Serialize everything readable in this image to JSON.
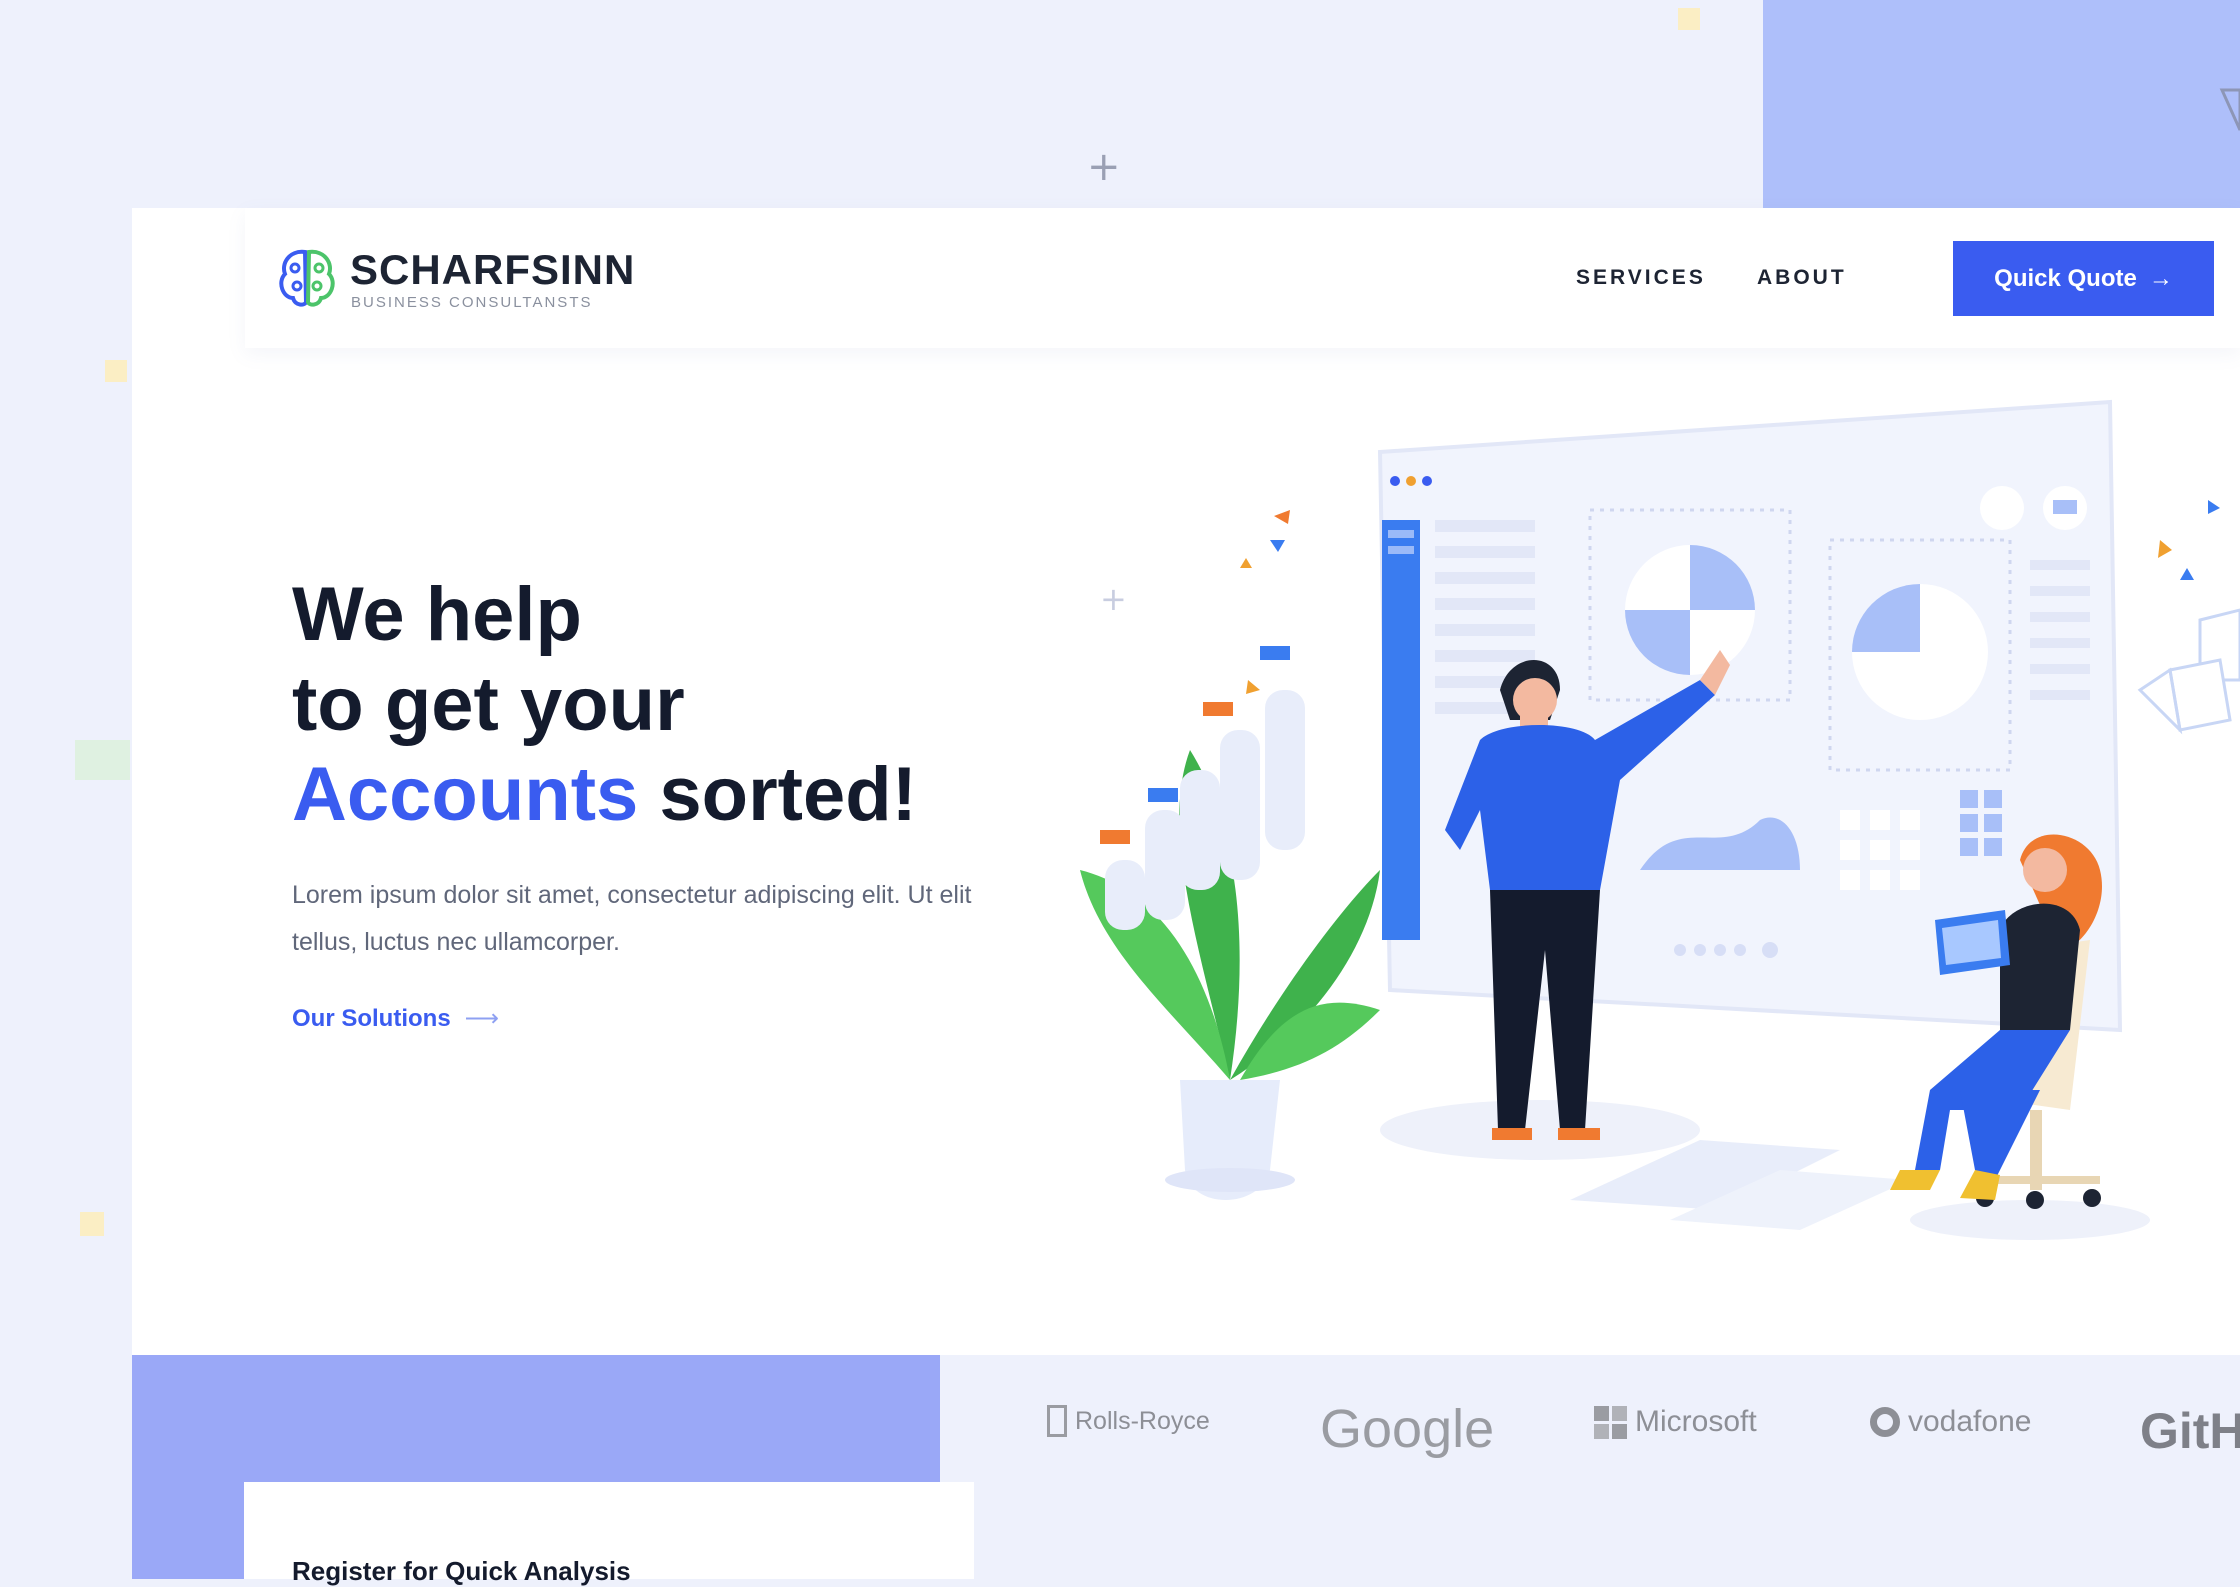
{
  "brand": {
    "name": "SCHARFSINN",
    "tagline": "BUSINESS CONSULTANSTS"
  },
  "nav": {
    "services": "SERVICES",
    "about": "ABOUT",
    "quick_quote": "Quick Quote"
  },
  "hero": {
    "line1": "We help",
    "line2": "to get your",
    "accent_word": "Accounts",
    "line3_rest": "sorted!",
    "description": "Lorem ipsum dolor sit amet, consectetur adipiscing elit. Ut elit tellus, luctus nec ullamcorper.",
    "cta_label": "Our Solutions"
  },
  "clients": {
    "rolls_royce": "Rolls-Royce",
    "google": "Google",
    "microsoft": "Microsoft",
    "vodafone": "vodafone",
    "github": "GitH"
  },
  "register": {
    "title": "Register for Quick Analysis"
  },
  "colors": {
    "accent": "#3a5cf0",
    "heading": "#141b2d",
    "panel": "#9aa8f7"
  }
}
